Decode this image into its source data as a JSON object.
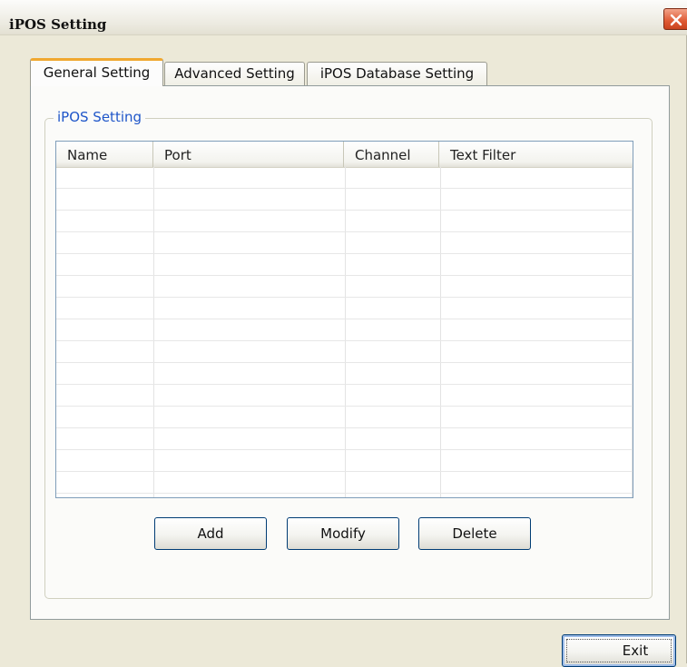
{
  "window": {
    "title": "iPOS Setting"
  },
  "tabs": [
    {
      "label": "General Setting",
      "active": true
    },
    {
      "label": "Advanced Setting",
      "active": false
    },
    {
      "label": "iPOS Database Setting",
      "active": false
    }
  ],
  "group": {
    "legend": "iPOS Setting"
  },
  "table": {
    "columns": [
      "Name",
      "Port",
      "Channel",
      "Text Filter"
    ],
    "rows": []
  },
  "buttons": {
    "add": "Add",
    "modify": "Modify",
    "delete": "Delete",
    "exit": "Exit"
  },
  "colors": {
    "group_legend": "#1f56c9",
    "active_tab_accent": "#f0a830",
    "close_button": "#df5a34"
  },
  "icons": {
    "close": "close-icon"
  }
}
